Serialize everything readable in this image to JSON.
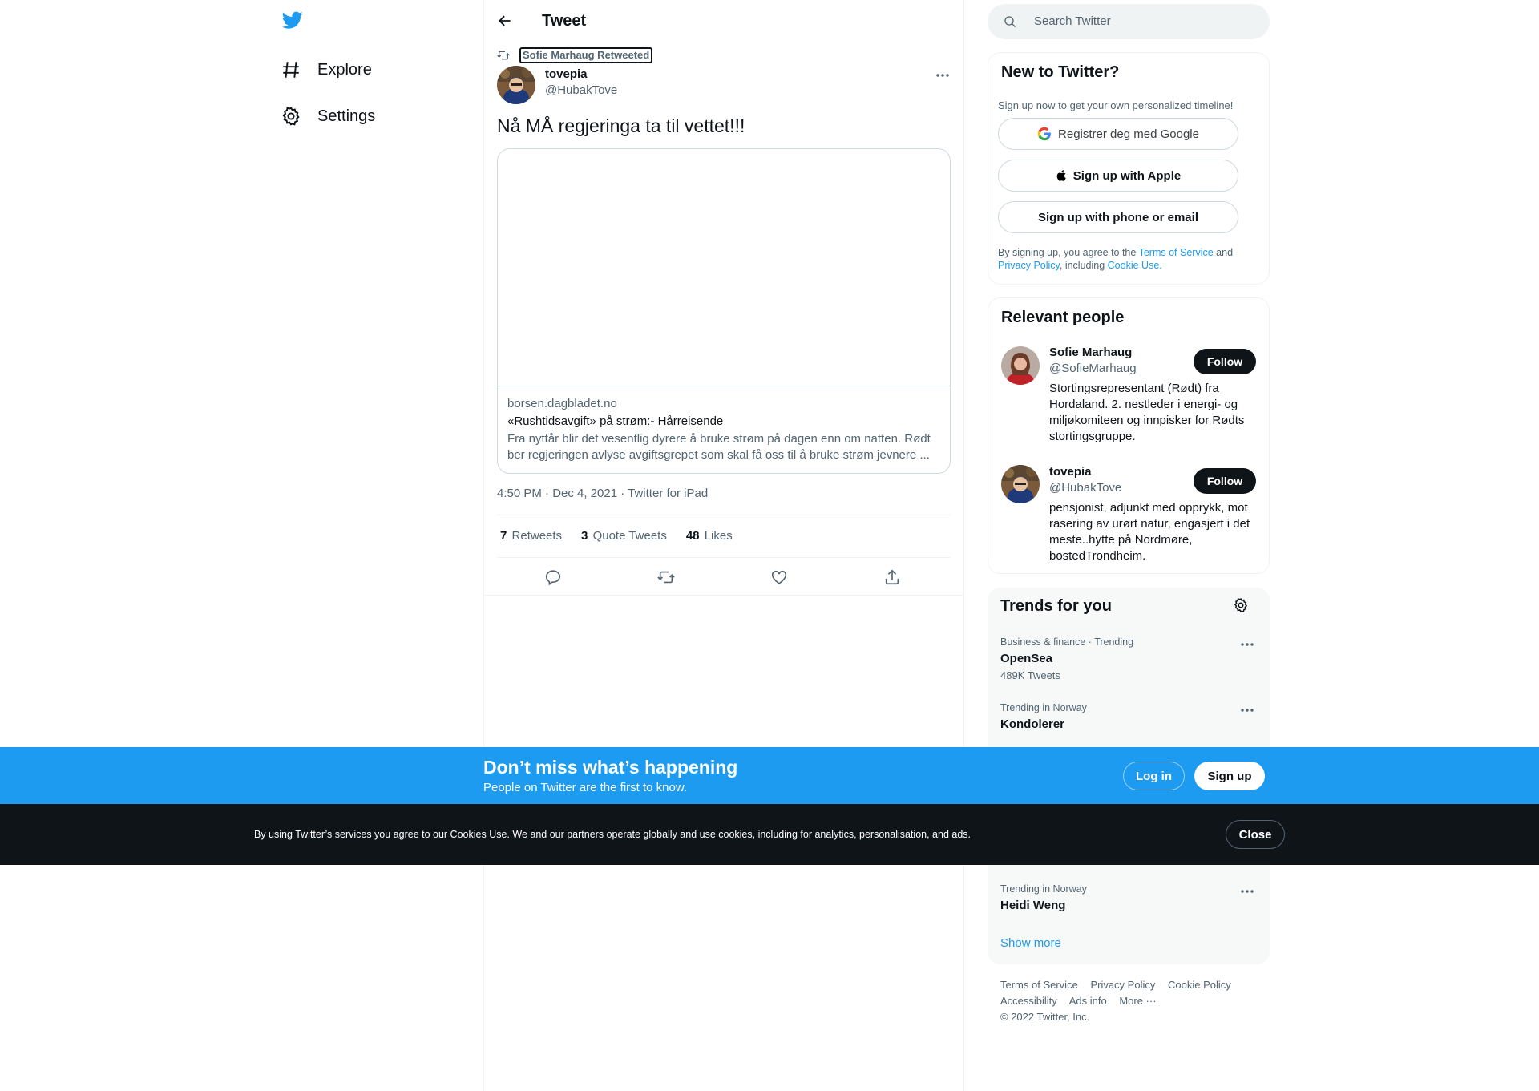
{
  "nav": {
    "explore": "Explore",
    "settings": "Settings"
  },
  "header": {
    "title": "Tweet"
  },
  "tweet": {
    "retweeted_by": "Sofie Marhaug Retweeted",
    "author_name": "tovepia",
    "author_handle": "@HubakTove",
    "text": "Nå MÅ regjeringa ta til vettet!!!",
    "card": {
      "domain": "borsen.dagbladet.no",
      "title": "«Rushtidsavgift» på strøm:- Hårreisende",
      "description": "Fra nyttår blir det vesentlig dyrere å bruke strøm på dagen enn om natten. Rødt ber regjeringen avlyse avgiftsgrepet som skal få oss til å bruke strøm jevnere ..."
    },
    "meta": "4:50 PM · Dec 4, 2021 · Twitter for iPad",
    "stats": {
      "retweets_count": "7",
      "retweets_label": "Retweets",
      "quotes_count": "3",
      "quotes_label": "Quote Tweets",
      "likes_count": "48",
      "likes_label": "Likes"
    }
  },
  "search": {
    "placeholder": "Search Twitter"
  },
  "new_to_twitter": {
    "title": "New to Twitter?",
    "subtitle": "Sign up now to get your own personalized timeline!",
    "google_button": "Registrer deg med Google",
    "apple_button": "Sign up with Apple",
    "phone_button": "Sign up with phone or email",
    "legal_prefix": "By signing up, you agree to the",
    "terms_link": "Terms of Service",
    "and": "and",
    "privacy_link": "Privacy Policy",
    "including": ", including",
    "cookie_link": "Cookie Use."
  },
  "relevant_people": {
    "title": "Relevant people",
    "people": [
      {
        "name": "Sofie Marhaug",
        "handle": "@SofieMarhaug",
        "bio": "Stortingsrepresentant (Rødt) fra Hordaland. 2. nestleder i energi- og miljøkomiteen og innpisker for Rødts stortingsgruppe.",
        "follow": "Follow"
      },
      {
        "name": "tovepia",
        "handle": "@HubakTove",
        "bio": "pensjonist, adjunkt med opprykk, mot rasering av urørt natur, engasjert i det meste..hytte på Nordmøre, bostedTrondheim.",
        "follow": "Follow"
      }
    ]
  },
  "trends": {
    "title": "Trends for you",
    "items": [
      {
        "meta": "Business & finance · Trending",
        "name": "OpenSea",
        "count": "489K Tweets"
      },
      {
        "meta": "Trending in Norway",
        "name": "Kondolerer",
        "count": ""
      },
      {
        "meta": "Trending in Norway",
        "name": "Heidi Weng",
        "count": ""
      }
    ],
    "show_more": "Show more"
  },
  "footer": {
    "links_row1": [
      "Terms of Service",
      "Privacy Policy",
      "Cookie Policy"
    ],
    "links_row2": [
      "Accessibility",
      "Ads info",
      "More ···"
    ],
    "copyright": "© 2022 Twitter, Inc."
  },
  "signup_bar": {
    "title": "Don’t miss what’s happening",
    "subtitle": "People on Twitter are the first to know.",
    "login": "Log in",
    "signup": "Sign up"
  },
  "cookie_bar": {
    "text": "By using Twitter’s services you agree to our Cookies Use. We and our partners operate globally and use cookies, including for analytics, personalisation, and ads.",
    "close": "Close"
  },
  "colors": {
    "accent": "#1d9bf0",
    "text_primary": "#0f1419",
    "text_secondary": "#536471",
    "border": "#eff3f4",
    "cookie_bg": "#0f1419"
  }
}
